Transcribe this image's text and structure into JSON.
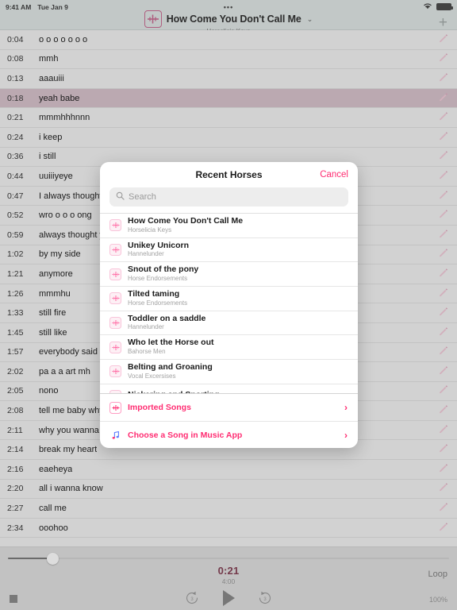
{
  "status_bar": {
    "time": "9:41 AM",
    "date": "Tue Jan 9",
    "center_dots": "•••",
    "wifi_icon": "wifi-icon",
    "battery_icon": "battery-icon"
  },
  "navbar": {
    "song_icon": "song-waveform-icon",
    "title": "How Come You Don't Call Me",
    "chevron": "⌄",
    "subtitle": "Horselicia Keys",
    "add_label": "+"
  },
  "lyrics": {
    "edit_icon": "pencil-icon",
    "rows": [
      {
        "time": "0:04",
        "text": "o o o o o o o",
        "active": false
      },
      {
        "time": "0:08",
        "text": "mmh",
        "active": false
      },
      {
        "time": "0:13",
        "text": "aaauiii",
        "active": false
      },
      {
        "time": "0:18",
        "text": "yeah babe",
        "active": true
      },
      {
        "time": "0:21",
        "text": "mmmhhhnnn",
        "active": false
      },
      {
        "time": "0:24",
        "text": "i keep",
        "active": false
      },
      {
        "time": "0:36",
        "text": "i still",
        "active": false
      },
      {
        "time": "0:44",
        "text": "uuiiiyeye",
        "active": false
      },
      {
        "time": "0:47",
        "text": "I always thought",
        "active": false
      },
      {
        "time": "0:52",
        "text": "wro o o o ong",
        "active": false
      },
      {
        "time": "0:59",
        "text": "always thought you'd",
        "active": false
      },
      {
        "time": "1:02",
        "text": "by my side",
        "active": false
      },
      {
        "time": "1:21",
        "text": "anymore",
        "active": false
      },
      {
        "time": "1:26",
        "text": "mmmhu",
        "active": false
      },
      {
        "time": "1:33",
        "text": "still fire",
        "active": false
      },
      {
        "time": "1:45",
        "text": "still like",
        "active": false
      },
      {
        "time": "1:57",
        "text": "everybody said",
        "active": false
      },
      {
        "time": "2:02",
        "text": "pa a a art mh",
        "active": false
      },
      {
        "time": "2:05",
        "text": "nono",
        "active": false
      },
      {
        "time": "2:08",
        "text": "tell me baby why",
        "active": false
      },
      {
        "time": "2:11",
        "text": "why you wanna go",
        "active": false
      },
      {
        "time": "2:14",
        "text": "break my heart",
        "active": false
      },
      {
        "time": "2:16",
        "text": "eaeheya",
        "active": false
      },
      {
        "time": "2:20",
        "text": "all i wanna know",
        "active": false
      },
      {
        "time": "2:27",
        "text": "call me",
        "active": false
      },
      {
        "time": "2:34",
        "text": "ooohoo",
        "active": false
      }
    ]
  },
  "player": {
    "current_time": "0:21",
    "total_time": "4:00",
    "progress_percent": 10,
    "stop_icon": "stop-icon",
    "rewind_label": "3",
    "rewind_icon": "rewind-3-icon",
    "play_icon": "play-icon",
    "forward_label": "3",
    "forward_icon": "forward-3-icon",
    "loop_label": "Loop",
    "speed_label": "100%",
    "accent_time_color": "#9d3050"
  },
  "modal": {
    "title": "Recent Horses",
    "cancel_label": "Cancel",
    "search": {
      "placeholder": "Search",
      "value": "",
      "icon": "search-icon"
    },
    "songs": [
      {
        "name": "How Come You Don't Call Me",
        "artist": "Horselicia Keys"
      },
      {
        "name": "Unikey Unicorn",
        "artist": "Hannelunder"
      },
      {
        "name": "Snout of the pony",
        "artist": "Horse Endorsements"
      },
      {
        "name": "Tilted taming",
        "artist": "Horse Endorsements"
      },
      {
        "name": "Toddler on a saddle",
        "artist": "Hannelunder"
      },
      {
        "name": "Who let the Horse out",
        "artist": "Bahorse Men"
      },
      {
        "name": "Belting and Groaning",
        "artist": "Vocal Excersises"
      },
      {
        "name": "Nickering and Snorting",
        "artist": ""
      }
    ],
    "footer": [
      {
        "label": "Imported Songs",
        "icon": "song-waveform-icon",
        "chevron": "›"
      },
      {
        "label": "Choose a Song in Music App",
        "icon": "music-note-icon",
        "chevron": "›"
      }
    ],
    "accent_color": "#ff2d72"
  }
}
